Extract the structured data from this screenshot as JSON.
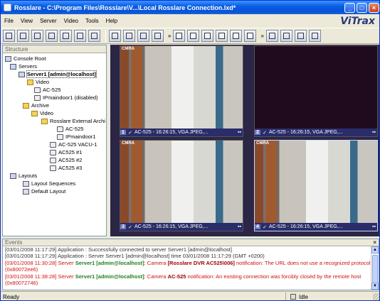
{
  "window": {
    "title": "Rosslare - C:\\Program Files\\Rosslare\\V...\\Local Rosslare Connection.lxd*"
  },
  "menu": [
    "File",
    "View",
    "Server",
    "Video",
    "Tools",
    "Help"
  ],
  "brand": "ViTrax",
  "structure": {
    "header": "Structure",
    "nodes": [
      {
        "label": "Console Root"
      },
      {
        "label": "Servers"
      },
      {
        "label": "Server1 [admin@localhost]"
      },
      {
        "label": "Video"
      },
      {
        "label": "AC-525"
      },
      {
        "label": "IPmaindoor1 (disabled)"
      },
      {
        "label": "Archive"
      },
      {
        "label": "Video"
      },
      {
        "label": "Rosslare External Archi"
      },
      {
        "label": "AC-525"
      },
      {
        "label": "IPmaindoor1"
      },
      {
        "label": "AC-525 VACU-1"
      },
      {
        "label": "AC525 #1"
      },
      {
        "label": "AC525 #2"
      },
      {
        "label": "AC525 #3"
      },
      {
        "label": "Layouts"
      },
      {
        "label": "Layout Sequences"
      },
      {
        "label": "Default Layout"
      }
    ]
  },
  "video_cells": [
    {
      "cam": "CMRA",
      "number": "1",
      "info": "AC-525 - 16:26:15, VGA JPEG,..."
    },
    {
      "cam": "",
      "number": "2",
      "info": "AC-525 - 16:26:15, VGA JPEG,..."
    },
    {
      "cam": "CMRA",
      "number": "3",
      "info": "AC-525 - 16:26:15, VGA JPEG,..."
    },
    {
      "cam": "CMRA",
      "number": "4",
      "info": "AC-525 - 16:26:15, VGA JPEG,..."
    }
  ],
  "events": {
    "header": "Events",
    "close": "×",
    "rows": [
      {
        "text": "[03/01/2008 11:17:29] Application : Successfully connected to server Server1 [admin@localhost]"
      },
      {
        "text": "[03/01/2008 11:17:29] Application : Server Server1 [admin@localhost] time 03/01/2008 11:17:29 (GMT +0200)"
      },
      {
        "prefix": "[03/01/2008 11:30:28] Server ",
        "server": "Server1 [admin@localhost]",
        "mid": ": Camera ",
        "cam": "[Rosslare DVR AC525\\006]",
        "rest": " notification: The URL does not use a recognized protocol (0x80072ee6)"
      },
      {
        "prefix": "[03/01/2008 11:38:28] Server ",
        "server": "Server1 [admin@localhost]",
        "mid": ": Camera ",
        "cam": "AC-525",
        "rest": " notification: An existing connection was forcibly closed by the remote host (0x80072746)"
      }
    ]
  },
  "status": {
    "left": "Ready",
    "right": "Idle"
  }
}
